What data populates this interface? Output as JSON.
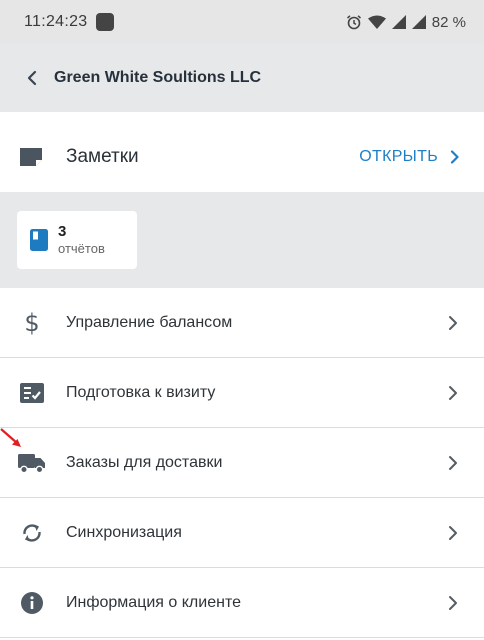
{
  "status_bar": {
    "time": "11:24:23",
    "battery": "82 %"
  },
  "header": {
    "title": "Green White Soultions LLC"
  },
  "notes": {
    "title": "Заметки",
    "action": "ОТКРЫТЬ"
  },
  "reports": {
    "count": "3",
    "label": "отчётов"
  },
  "menu": [
    {
      "label": "Управление балансом",
      "icon": "dollar-icon"
    },
    {
      "label": "Подготовка к визиту",
      "icon": "checklist-icon"
    },
    {
      "label": "Заказы для доставки",
      "icon": "truck-icon"
    },
    {
      "label": "Синхронизация",
      "icon": "sync-icon"
    },
    {
      "label": "Информация о клиенте",
      "icon": "info-icon"
    }
  ],
  "colors": {
    "accent": "#1e7fc6",
    "icon": "#505a64",
    "header_bg": "#e6e8ea"
  }
}
